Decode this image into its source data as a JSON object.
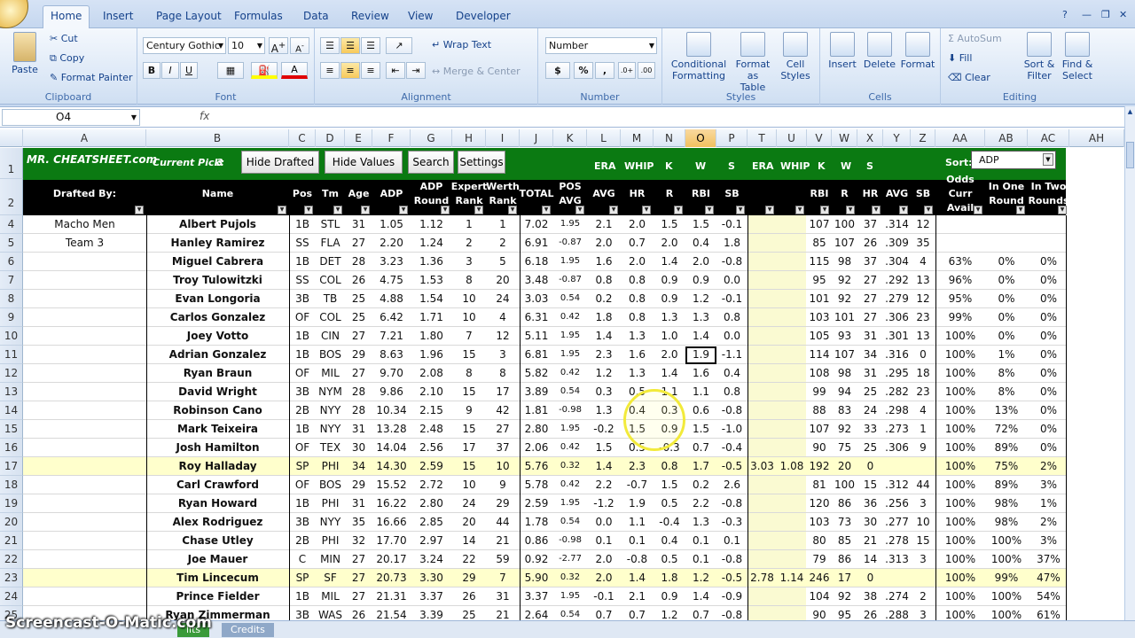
{
  "ribbon": {
    "tabs": [
      "Home",
      "Insert",
      "Page Layout",
      "Formulas",
      "Data",
      "Review",
      "View",
      "Developer"
    ],
    "clipboard": {
      "paste": "Paste",
      "cut": "Cut",
      "copy": "Copy",
      "format_painter": "Format Painter",
      "label": "Clipboard"
    },
    "font": {
      "family": "Century Gothic",
      "size": "10",
      "label": "Font",
      "bold": "B",
      "italic": "I",
      "underline": "U"
    },
    "alignment": {
      "wrap": "Wrap Text",
      "merge": "Merge & Center",
      "label": "Alignment"
    },
    "number": {
      "format": "Number",
      "currency": "$",
      "percent": "%",
      "comma": ",",
      "label": "Number"
    },
    "styles": {
      "conditional": "Conditional Formatting",
      "format_table": "Format as Table",
      "cell_styles": "Cell Styles",
      "label": "Styles"
    },
    "cells": {
      "insert": "Insert",
      "delete": "Delete",
      "format": "Format",
      "label": "Cells"
    },
    "editing": {
      "autosum": "AutoSum",
      "fill": "Fill",
      "clear": "Clear",
      "sort": "Sort & Filter",
      "find": "Find & Select",
      "label": "Editing"
    }
  },
  "formula_bar": {
    "name_box": "O4",
    "fx": "fx",
    "formula": ""
  },
  "columns": [
    "A",
    "B",
    "C",
    "D",
    "E",
    "F",
    "G",
    "H",
    "I",
    "J",
    "K",
    "L",
    "M",
    "N",
    "O",
    "P",
    "T",
    "U",
    "V",
    "W",
    "X",
    "Y",
    "Z",
    "AA",
    "AB",
    "AC",
    "AH"
  ],
  "row_numbers": [
    "1",
    "2",
    "4",
    "5",
    "6",
    "7",
    "8",
    "9",
    "10",
    "11",
    "12",
    "13",
    "14",
    "15",
    "16",
    "17",
    "18",
    "19",
    "20",
    "21",
    "22",
    "23",
    "24",
    "25"
  ],
  "header": {
    "logo": "MR. CHEATSHEET.com",
    "current_pick_label": "Current Pick:",
    "current_pick_value": "3",
    "btn_hide_drafted": "Hide Drafted",
    "btn_hide_values": "Hide Values",
    "btn_search": "Search",
    "btn_settings": "Settings",
    "sort_label": "Sort:",
    "sort_value": "ADP",
    "row1_labels": {
      "era1": "ERA",
      "whip1": "WHIP",
      "k1": "K",
      "w1": "W",
      "s1": "S",
      "era2": "ERA",
      "whip2": "WHIP",
      "k2": "K",
      "w2": "W",
      "s2": "S"
    },
    "row2_labels": {
      "drafted": "Drafted By:",
      "name": "Name",
      "pos": "Pos",
      "tm": "Tm",
      "age": "Age",
      "adp": "ADP",
      "adp_round": "ADP Round",
      "expert_rank": "Expert Rank",
      "werth_rank": "Werth Rank",
      "total": "TOTAL",
      "pos_avg": "POS AVG",
      "avg": "AVG",
      "hr": "HR",
      "r": "R",
      "rbi": "RBI",
      "sb": "SB",
      "rbi2": "RBI",
      "r2": "R",
      "hr2": "HR",
      "avg2": "AVG",
      "sb2": "SB",
      "odds": "Odds Curr Avail",
      "in_one": "In One Round",
      "in_two": "In Two Rounds"
    }
  },
  "rows": [
    [
      "Macho Men",
      "Albert Pujols",
      "1B",
      "STL",
      "31",
      "1.05",
      "1.12",
      "1",
      "1",
      "7.02",
      "1.95",
      "2.1",
      "2.0",
      "1.5",
      "1.5",
      "-0.1",
      "",
      "",
      "107",
      "100",
      "37",
      ".314",
      "12",
      "",
      "",
      ""
    ],
    [
      "Team 3",
      "Hanley Ramirez",
      "SS",
      "FLA",
      "27",
      "2.20",
      "1.24",
      "2",
      "2",
      "6.91",
      "-0.87",
      "2.0",
      "0.7",
      "2.0",
      "0.4",
      "1.8",
      "",
      "",
      "85",
      "107",
      "26",
      ".309",
      "35",
      "",
      "",
      ""
    ],
    [
      "",
      "Miguel Cabrera",
      "1B",
      "DET",
      "28",
      "3.23",
      "1.36",
      "3",
      "5",
      "6.18",
      "1.95",
      "1.6",
      "2.0",
      "1.4",
      "2.0",
      "-0.8",
      "",
      "",
      "115",
      "98",
      "37",
      ".304",
      "4",
      "63%",
      "0%",
      "0%"
    ],
    [
      "",
      "Troy Tulowitzki",
      "SS",
      "COL",
      "26",
      "4.75",
      "1.53",
      "8",
      "20",
      "3.48",
      "-0.87",
      "0.8",
      "0.8",
      "0.9",
      "0.9",
      "0.0",
      "",
      "",
      "95",
      "92",
      "27",
      ".292",
      "13",
      "96%",
      "0%",
      "0%"
    ],
    [
      "",
      "Evan Longoria",
      "3B",
      "TB",
      "25",
      "4.88",
      "1.54",
      "10",
      "24",
      "3.03",
      "0.54",
      "0.2",
      "0.8",
      "0.9",
      "1.2",
      "-0.1",
      "",
      "",
      "101",
      "92",
      "27",
      ".279",
      "12",
      "95%",
      "0%",
      "0%"
    ],
    [
      "",
      "Carlos Gonzalez",
      "OF",
      "COL",
      "25",
      "6.42",
      "1.71",
      "10",
      "4",
      "6.31",
      "0.42",
      "1.8",
      "0.8",
      "1.3",
      "1.3",
      "0.8",
      "",
      "",
      "103",
      "101",
      "27",
      ".306",
      "23",
      "99%",
      "0%",
      "0%"
    ],
    [
      "",
      "Joey Votto",
      "1B",
      "CIN",
      "27",
      "7.21",
      "1.80",
      "7",
      "12",
      "5.11",
      "1.95",
      "1.4",
      "1.3",
      "1.0",
      "1.4",
      "0.0",
      "",
      "",
      "105",
      "93",
      "31",
      ".301",
      "13",
      "100%",
      "0%",
      "0%"
    ],
    [
      "",
      "Adrian Gonzalez",
      "1B",
      "BOS",
      "29",
      "8.63",
      "1.96",
      "15",
      "3",
      "6.81",
      "1.95",
      "2.3",
      "1.6",
      "2.0",
      "1.9",
      "-1.1",
      "",
      "",
      "114",
      "107",
      "34",
      ".316",
      "0",
      "100%",
      "1%",
      "0%"
    ],
    [
      "",
      "Ryan Braun",
      "OF",
      "MIL",
      "27",
      "9.70",
      "2.08",
      "8",
      "8",
      "5.82",
      "0.42",
      "1.2",
      "1.3",
      "1.4",
      "1.6",
      "0.4",
      "",
      "",
      "108",
      "98",
      "31",
      ".295",
      "18",
      "100%",
      "8%",
      "0%"
    ],
    [
      "",
      "David Wright",
      "3B",
      "NYM",
      "28",
      "9.86",
      "2.10",
      "15",
      "17",
      "3.89",
      "0.54",
      "0.3",
      "0.5",
      "1.1",
      "1.1",
      "0.8",
      "",
      "",
      "99",
      "94",
      "25",
      ".282",
      "23",
      "100%",
      "8%",
      "0%"
    ],
    [
      "",
      "Robinson Cano",
      "2B",
      "NYY",
      "28",
      "10.34",
      "2.15",
      "9",
      "42",
      "1.81",
      "-0.98",
      "1.3",
      "0.4",
      "0.3",
      "0.6",
      "-0.8",
      "",
      "",
      "88",
      "83",
      "24",
      ".298",
      "4",
      "100%",
      "13%",
      "0%"
    ],
    [
      "",
      "Mark Teixeira",
      "1B",
      "NYY",
      "31",
      "13.28",
      "2.48",
      "15",
      "27",
      "2.80",
      "1.95",
      "-0.2",
      "1.5",
      "0.9",
      "1.5",
      "-1.0",
      "",
      "",
      "107",
      "92",
      "33",
      ".273",
      "1",
      "100%",
      "72%",
      "0%"
    ],
    [
      "",
      "Josh Hamilton",
      "OF",
      "TEX",
      "30",
      "14.04",
      "2.56",
      "17",
      "37",
      "2.06",
      "0.42",
      "1.5",
      "0.5",
      "-0.3",
      "0.7",
      "-0.4",
      "",
      "",
      "90",
      "75",
      "25",
      ".306",
      "9",
      "100%",
      "89%",
      "0%"
    ],
    [
      "",
      "Roy Halladay",
      "SP",
      "PHI",
      "34",
      "14.30",
      "2.59",
      "15",
      "10",
      "5.76",
      "0.32",
      "1.4",
      "2.3",
      "0.8",
      "1.7",
      "-0.5",
      "3.03",
      "1.08",
      "192",
      "20",
      "0",
      "",
      "",
      "100%",
      "75%",
      "2%"
    ],
    [
      "",
      "Carl Crawford",
      "OF",
      "BOS",
      "29",
      "15.52",
      "2.72",
      "10",
      "9",
      "5.78",
      "0.42",
      "2.2",
      "-0.7",
      "1.5",
      "0.2",
      "2.6",
      "",
      "",
      "81",
      "100",
      "15",
      ".312",
      "44",
      "100%",
      "89%",
      "3%"
    ],
    [
      "",
      "Ryan Howard",
      "1B",
      "PHI",
      "31",
      "16.22",
      "2.80",
      "24",
      "29",
      "2.59",
      "1.95",
      "-1.2",
      "1.9",
      "0.5",
      "2.2",
      "-0.8",
      "",
      "",
      "120",
      "86",
      "36",
      ".256",
      "3",
      "100%",
      "98%",
      "1%"
    ],
    [
      "",
      "Alex Rodriguez",
      "3B",
      "NYY",
      "35",
      "16.66",
      "2.85",
      "20",
      "44",
      "1.78",
      "0.54",
      "0.0",
      "1.1",
      "-0.4",
      "1.3",
      "-0.3",
      "",
      "",
      "103",
      "73",
      "30",
      ".277",
      "10",
      "100%",
      "98%",
      "2%"
    ],
    [
      "",
      "Chase Utley",
      "2B",
      "PHI",
      "32",
      "17.70",
      "2.97",
      "14",
      "21",
      "0.86",
      "-0.98",
      "0.1",
      "0.1",
      "0.4",
      "0.1",
      "0.1",
      "",
      "",
      "80",
      "85",
      "21",
      ".278",
      "15",
      "100%",
      "100%",
      "3%"
    ],
    [
      "",
      "Joe Mauer",
      "C",
      "MIN",
      "27",
      "20.17",
      "3.24",
      "22",
      "59",
      "0.92",
      "-2.77",
      "2.0",
      "-0.8",
      "0.5",
      "0.1",
      "-0.8",
      "",
      "",
      "79",
      "86",
      "14",
      ".313",
      "3",
      "100%",
      "100%",
      "37%"
    ],
    [
      "",
      "Tim Lincecum",
      "SP",
      "SF",
      "27",
      "20.73",
      "3.30",
      "29",
      "7",
      "5.90",
      "0.32",
      "2.0",
      "1.4",
      "1.8",
      "1.2",
      "-0.5",
      "2.78",
      "1.14",
      "246",
      "17",
      "0",
      "",
      "",
      "100%",
      "99%",
      "47%"
    ],
    [
      "",
      "Prince Fielder",
      "1B",
      "MIL",
      "27",
      "21.31",
      "3.37",
      "26",
      "31",
      "3.37",
      "1.95",
      "-0.1",
      "2.1",
      "0.9",
      "1.4",
      "-0.9",
      "",
      "",
      "104",
      "92",
      "38",
      ".274",
      "2",
      "100%",
      "100%",
      "54%"
    ],
    [
      "",
      "Ryan Zimmerman",
      "3B",
      "WAS",
      "26",
      "21.54",
      "3.39",
      "25",
      "21",
      "2.64",
      "0.54",
      "0.7",
      "0.7",
      "1.2",
      "0.7",
      "-0.8",
      "",
      "",
      "90",
      "95",
      "26",
      ".288",
      "3",
      "100%",
      "100%",
      "61%"
    ]
  ],
  "highlight_rows": [
    13,
    19
  ],
  "sheet_tabs": {
    "watermark": "Screencast-O-Matic.com",
    "tab1": "lits",
    "tab2": "Credits"
  },
  "colors": {
    "ribbon": "#dbe7f6",
    "header_green": "#0b7a12",
    "header_black": "#000000",
    "row_highlight": "#ffffcc",
    "pitcher_band": "#fafad2",
    "selected_col": "#f1c15f"
  }
}
